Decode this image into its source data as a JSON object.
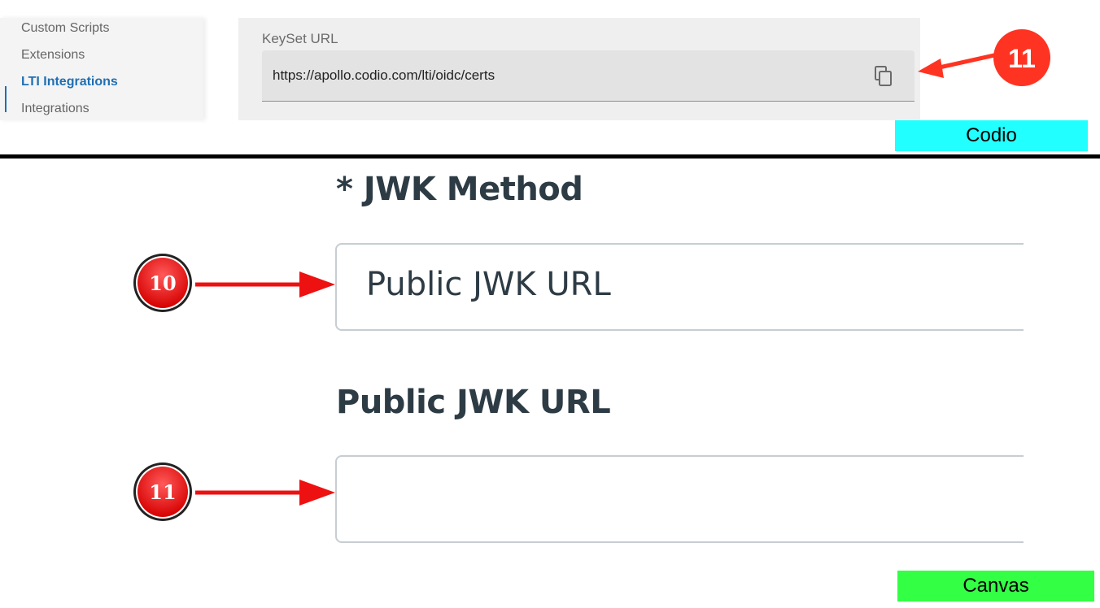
{
  "codio": {
    "sidebar": {
      "items": [
        {
          "label": "Custom Scripts",
          "active": false
        },
        {
          "label": "Extensions",
          "active": false
        },
        {
          "label": "LTI Integrations",
          "active": true
        },
        {
          "label": "Integrations",
          "active": false
        }
      ]
    },
    "keyset": {
      "label": "KeySet URL",
      "value": "https://apollo.codio.com/lti/oidc/certs",
      "copy_icon": "copy-icon"
    },
    "tag": "Codio"
  },
  "canvas": {
    "jwk_method": {
      "heading": "* JWK Method",
      "value": "Public JWK URL"
    },
    "public_jwk_url": {
      "heading": "Public JWK URL",
      "value": ""
    },
    "tag": "Canvas"
  },
  "annotations": {
    "marker_top": "11",
    "marker_jwk_method": "10",
    "marker_public_jwk": "11"
  },
  "colors": {
    "codio_tag_bg": "#22ffff",
    "canvas_tag_bg": "#33ff44",
    "marker_red": "#ff3322",
    "link_blue": "#1f6fb2",
    "canvas_text": "#2d3b45"
  }
}
